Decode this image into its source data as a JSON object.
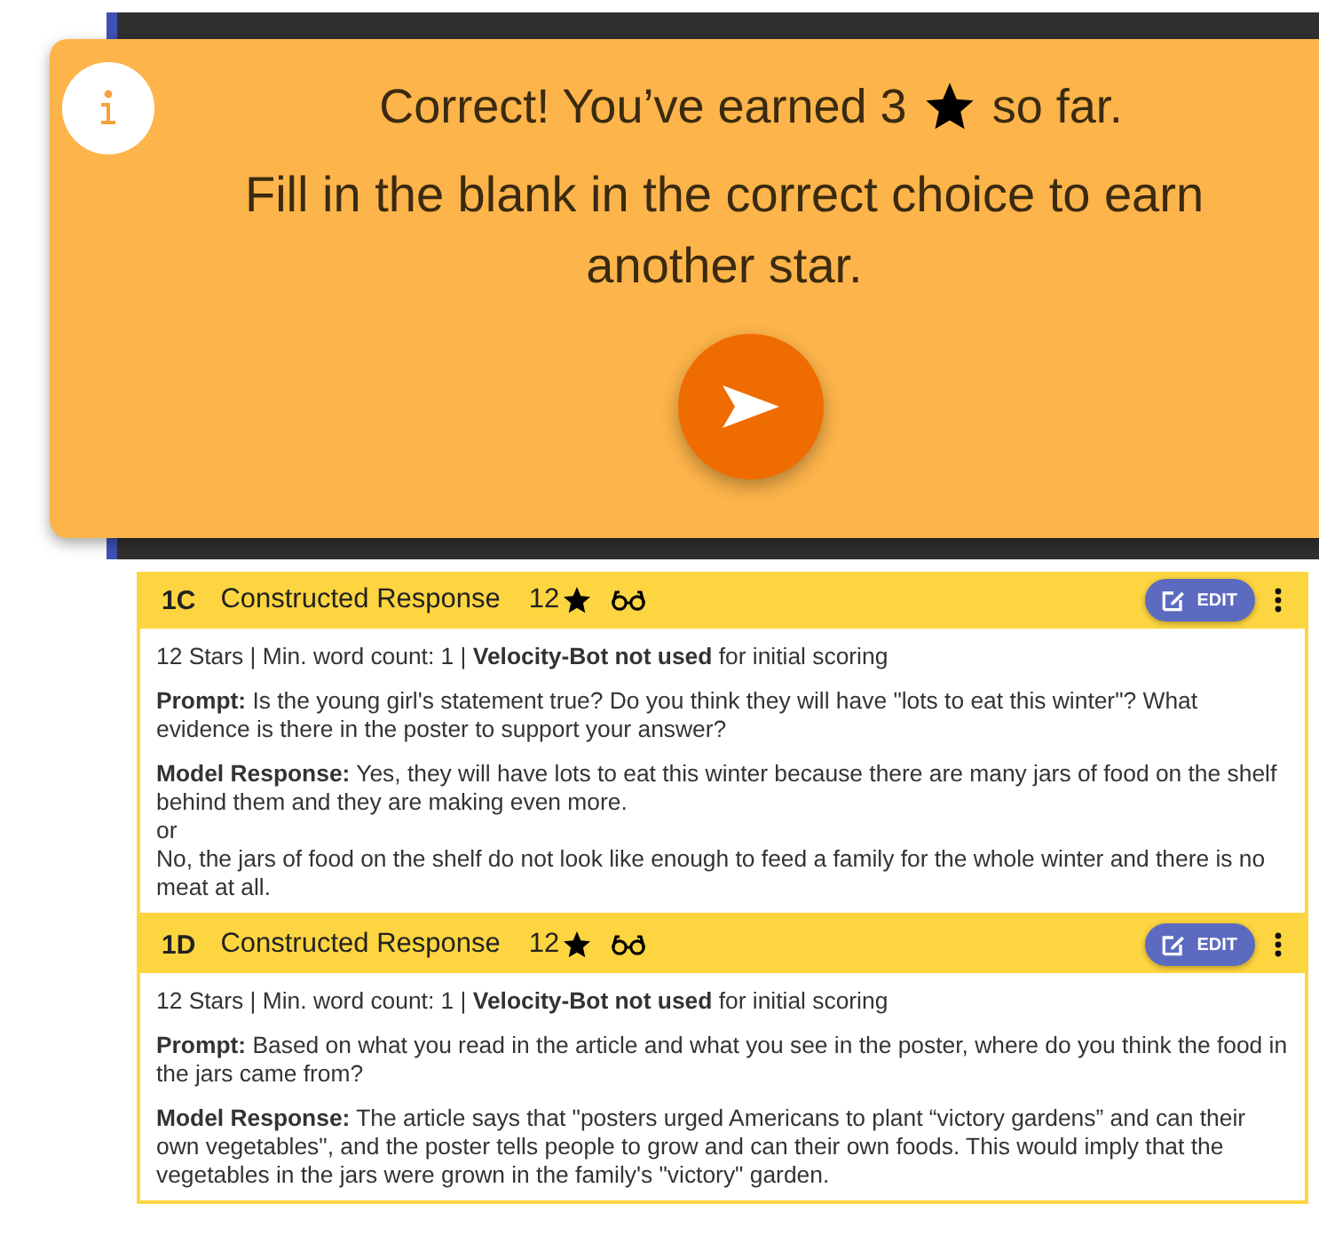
{
  "toast": {
    "message_before": "Correct! You’ve earned 3",
    "message_after": "so far.",
    "instruction": "Fill in the blank in the correct choice to earn another star."
  },
  "questions": [
    {
      "code": "1C",
      "type": "Constructed Response",
      "stars": "12",
      "edit_label": "EDIT",
      "meta": "12 Stars | Min. word count: 1 | **Velocity-Bot not used** for initial scoring",
      "prompt": "**Prompt:** Is the young girl's statement true? Do you think they will have \"lots to eat this winter\"? What evidence is there in the poster to support your answer?",
      "model_response": [
        "**Model Response:** Yes, they will have lots to eat this winter because there are many jars of food on the shelf behind them and they are making even more.",
        "or",
        "No, the jars of food on the shelf do not look like enough to feed a family for the whole winter and there is no meat at all."
      ]
    },
    {
      "code": "1D",
      "type": "Constructed Response",
      "stars": "12",
      "edit_label": "EDIT",
      "meta": "12 Stars | Min. word count: 1 | **Velocity-Bot not used** for initial scoring",
      "prompt": "**Prompt:** Based on what you read in the article and what you see in the poster, where do you think the food in the jars came from?",
      "model_response": [
        "**Model Response:** The article says that \"posters urged Americans to plant “victory gardens” and can their own vegetables\", and the poster tells people to grow and can their own foods. This would imply that the vegetables in the jars were grown in the family's \"victory\" garden."
      ]
    }
  ]
}
